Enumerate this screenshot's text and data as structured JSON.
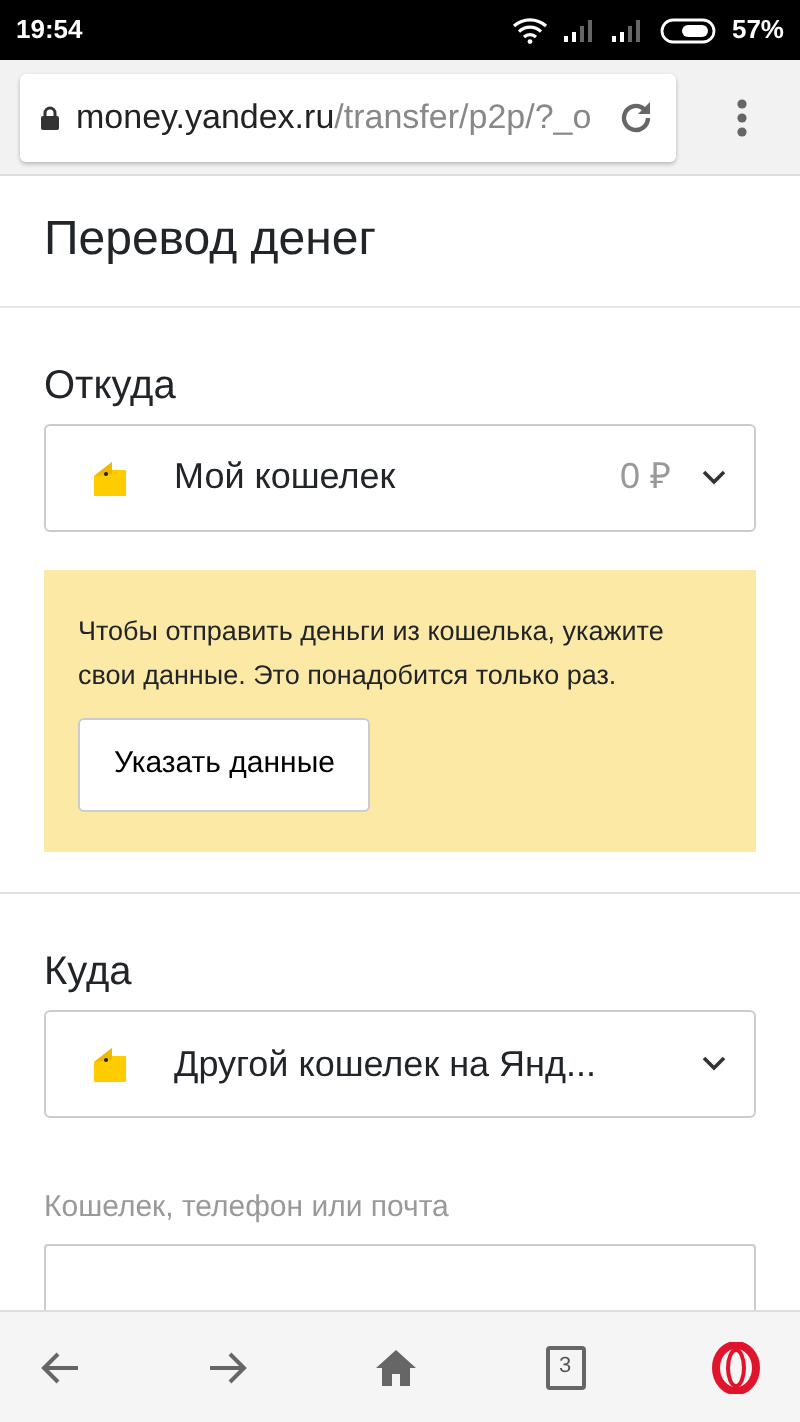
{
  "status_bar": {
    "time": "19:54",
    "battery": "57%"
  },
  "address_bar": {
    "host": "money.yandex.ru",
    "path": "/transfer/p2p/?_o"
  },
  "title": "Перевод денег",
  "from": {
    "label": "Откуда",
    "wallet": "Мой кошелек",
    "balance": "0 ₽"
  },
  "notice": {
    "text": "Чтобы отправить деньги из кошелька, укажите свои данные. Это понадобится только раз.",
    "button": "Указать данные"
  },
  "to": {
    "label": "Куда",
    "wallet": "Другой кошелек на Янд..."
  },
  "recipient": {
    "label": "Кошелек, телефон или почта"
  },
  "bottom_nav": {
    "tabs_count": "3"
  }
}
